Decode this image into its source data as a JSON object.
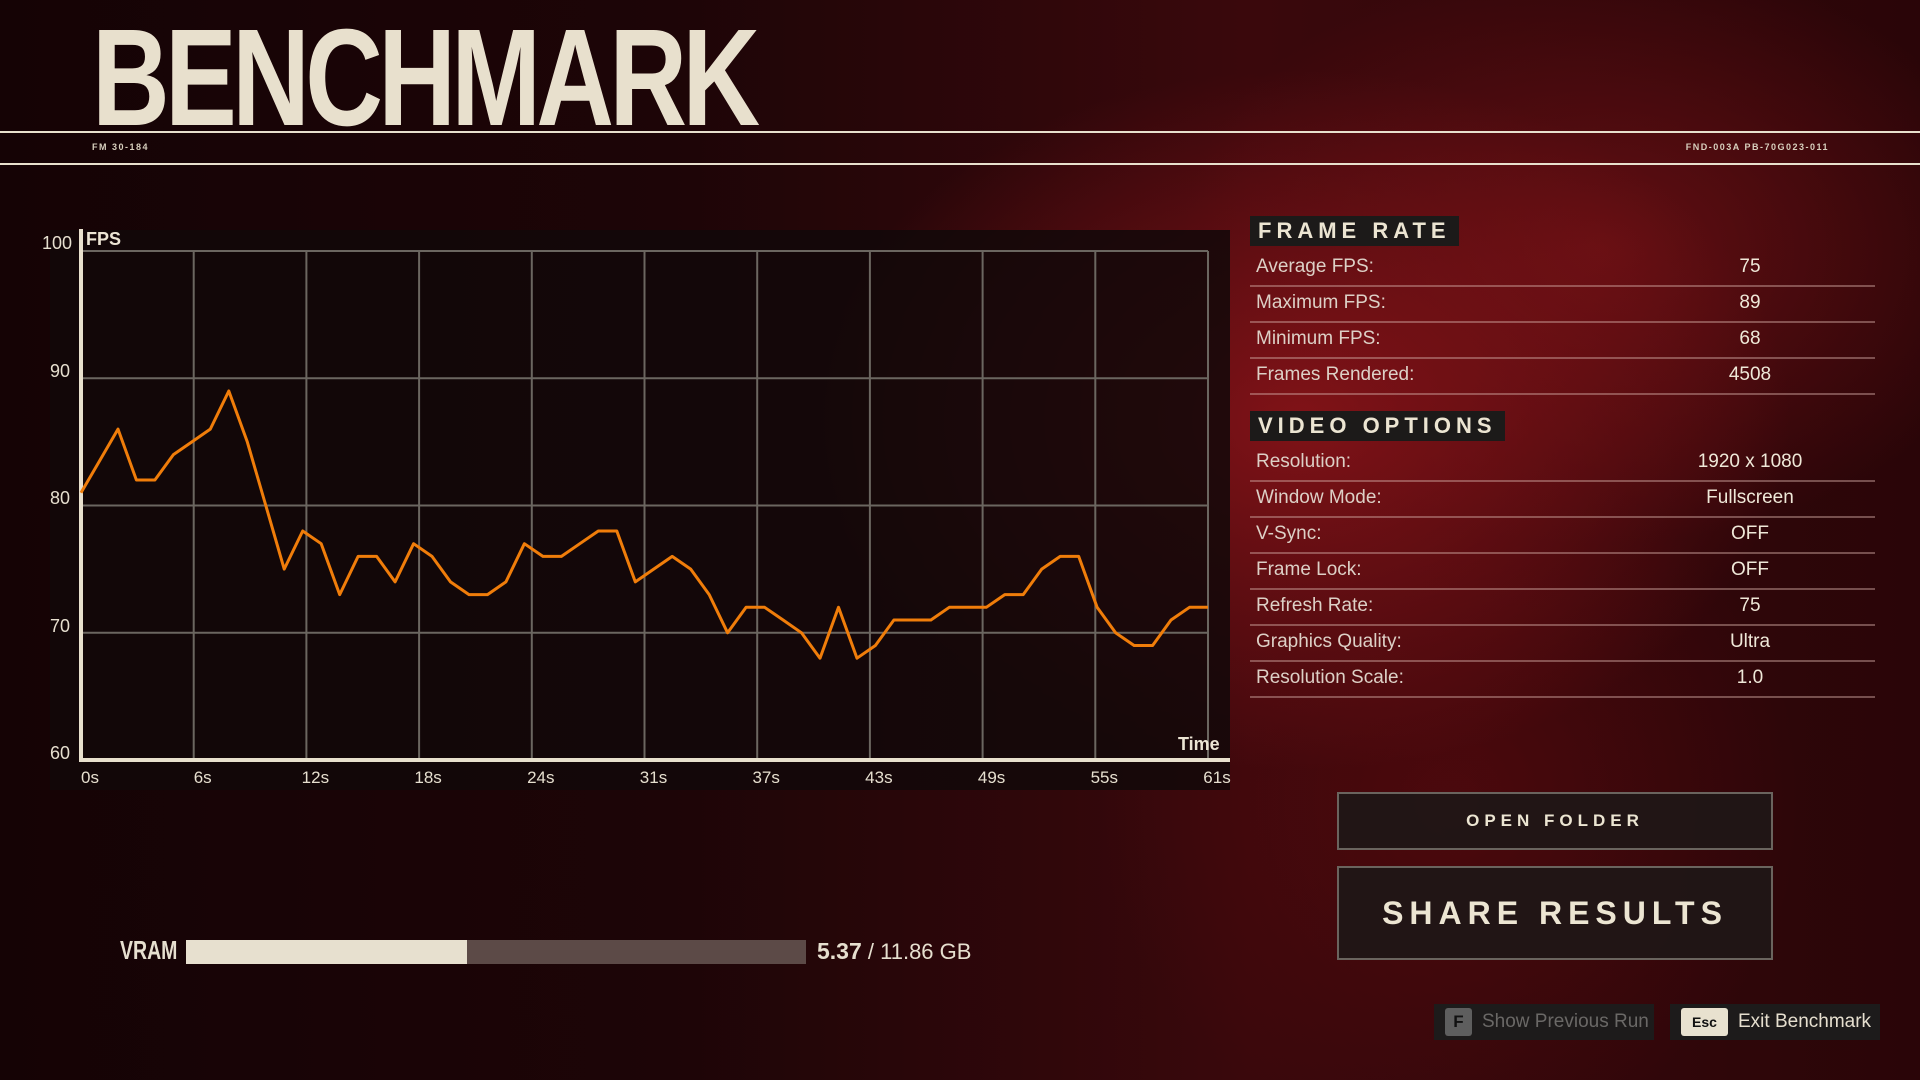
{
  "header": {
    "title": "BENCHMARK",
    "code_left": "FM 30-184",
    "code_right": "FND-003A PB-70G023-011"
  },
  "chart_data": {
    "type": "line",
    "title": "",
    "xlabel": "Time",
    "ylabel": "FPS",
    "ylim": [
      60,
      100
    ],
    "xlim": [
      0,
      61
    ],
    "y_ticks": [
      "100",
      "90",
      "80",
      "70",
      "60"
    ],
    "x_ticks": [
      "0s",
      "6s",
      "12s",
      "18s",
      "24s",
      "31s",
      "37s",
      "43s",
      "49s",
      "55s",
      "61s"
    ],
    "grid": true,
    "line_color": "#f07d0a",
    "series": [
      {
        "name": "FPS",
        "values": [
          81,
          83.5,
          86,
          82,
          82,
          84,
          85,
          86,
          89,
          85,
          80,
          75,
          78,
          77,
          73,
          76,
          76,
          74,
          77,
          76,
          74,
          73,
          73,
          74,
          77,
          76,
          76,
          77,
          78,
          78,
          74,
          75,
          76,
          75,
          73,
          70,
          72,
          72,
          71,
          70,
          68,
          72,
          68,
          69,
          71,
          71,
          71,
          72,
          72,
          72,
          73,
          73,
          75,
          76,
          76,
          72,
          70,
          69,
          69,
          71,
          72,
          72
        ]
      }
    ]
  },
  "vram": {
    "label": "VRAM",
    "used": "5.37",
    "total": "/ 11.86 GB",
    "fraction": 0.453
  },
  "frame_rate": {
    "heading": "FRAME RATE",
    "rows": [
      {
        "label": "Average FPS:",
        "value": "75"
      },
      {
        "label": "Maximum FPS:",
        "value": "89"
      },
      {
        "label": "Minimum FPS:",
        "value": "68"
      },
      {
        "label": "Frames Rendered:",
        "value": "4508"
      }
    ]
  },
  "video_options": {
    "heading": "VIDEO OPTIONS",
    "rows": [
      {
        "label": "Resolution:",
        "value": "1920 x 1080"
      },
      {
        "label": "Window Mode:",
        "value": "Fullscreen"
      },
      {
        "label": "V-Sync:",
        "value": "OFF"
      },
      {
        "label": "Frame Lock:",
        "value": "OFF"
      },
      {
        "label": "Refresh Rate:",
        "value": "75"
      },
      {
        "label": "Graphics Quality:",
        "value": "Ultra"
      },
      {
        "label": "Resolution Scale:",
        "value": "1.0"
      }
    ]
  },
  "buttons": {
    "open_folder": "OPEN FOLDER",
    "share_results": "SHARE RESULTS"
  },
  "hints": {
    "prev_key": "F",
    "prev_label": "Show Previous Run",
    "exit_key": "Esc",
    "exit_label": "Exit Benchmark"
  }
}
